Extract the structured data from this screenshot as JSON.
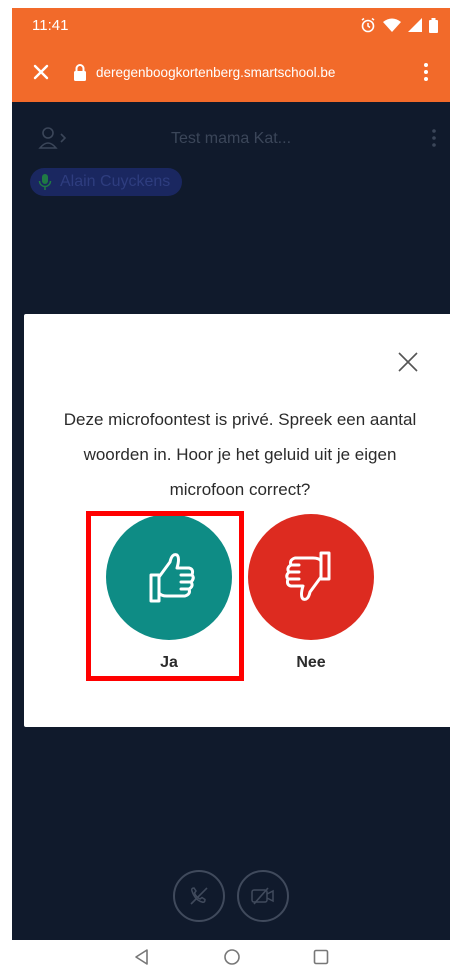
{
  "status_bar": {
    "time": "11:41",
    "icons": [
      "alarm-icon",
      "wifi-icon",
      "signal-icon",
      "battery-icon"
    ]
  },
  "browser": {
    "url": "deregenboogkortenberg.smartschool.be",
    "close_icon": "close-icon",
    "lock_icon": "lock-icon",
    "menu_icon": "more-vertical-icon"
  },
  "meeting": {
    "title": "Test mama Kat...",
    "speaker_name": "Alain Cuyckens"
  },
  "dialog": {
    "message": "Deze microfoontest is privé. Spreek een aantal woorden in. Hoor je het geluid uit je eigen microfoon correct?",
    "yes_label": "Ja",
    "no_label": "Nee"
  },
  "controls": {
    "buttons": [
      "phone-muted-icon",
      "video-off-icon"
    ]
  },
  "nav": {
    "buttons": [
      "back-icon",
      "home-icon",
      "recents-icon"
    ]
  },
  "colors": {
    "brand_orange": "#f26a2a",
    "meeting_bg": "#101a2c",
    "yes_green": "#0e8c85",
    "no_red": "#dd2b20",
    "highlight_red": "#ff0000"
  }
}
